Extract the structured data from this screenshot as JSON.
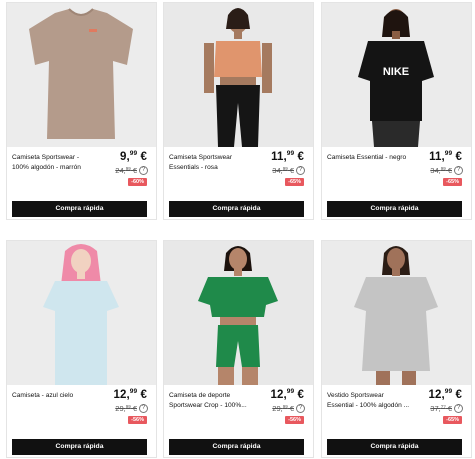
{
  "currency_symbol": "€",
  "colors": {
    "badge": "#e8585e",
    "button": "#111111",
    "image_bg": "#eaeaea"
  },
  "products": [
    {
      "name": "Camiseta Sportswear - 100% algodón - marrón",
      "price_int": "9,",
      "price_dec": "99",
      "price_cur": " €",
      "old_int": "24,",
      "old_dec": "99",
      "old_cur": " €",
      "discount": "-60%",
      "cta": "Compra rápida",
      "image": "brown-t-shirt-product-photo"
    },
    {
      "name": "Camiseta Sportswear Essentials - rosa",
      "price_int": "11,",
      "price_dec": "99",
      "price_cur": " €",
      "old_int": "34,",
      "old_dec": "99",
      "old_cur": " €",
      "discount": "-65%",
      "cta": "Compra rápida",
      "image": "model-pink-crop-top-photo"
    },
    {
      "name": "Camiseta Essential - negro",
      "price_int": "11,",
      "price_dec": "99",
      "price_cur": " €",
      "old_int": "34,",
      "old_dec": "99",
      "old_cur": " €",
      "discount": "-65%",
      "cta": "Compra rápida",
      "image": "model-black-nike-tee-photo"
    },
    {
      "name": "Camiseta - azul cielo",
      "price_int": "12,",
      "price_dec": "99",
      "price_cur": " €",
      "old_int": "29,",
      "old_dec": "99",
      "old_cur": " €",
      "discount": "-56%",
      "cta": "Compra rápida",
      "image": "model-light-blue-tee-photo"
    },
    {
      "name": "Camiseta de deporte Sportswear Crop - 100%...",
      "price_int": "12,",
      "price_dec": "99",
      "price_cur": " €",
      "old_int": "29,",
      "old_dec": "99",
      "old_cur": " €",
      "discount": "-56%",
      "cta": "Compra rápida",
      "image": "model-green-crop-set-photo"
    },
    {
      "name": "Vestido Sportswear Essential - 100% algodón ...",
      "price_int": "12,",
      "price_dec": "99",
      "price_cur": " €",
      "old_int": "37,",
      "old_dec": "??",
      "old_cur": " €",
      "discount": "-65%",
      "cta": "Compra rápida",
      "image": "model-grey-tshirt-dress-photo"
    }
  ]
}
